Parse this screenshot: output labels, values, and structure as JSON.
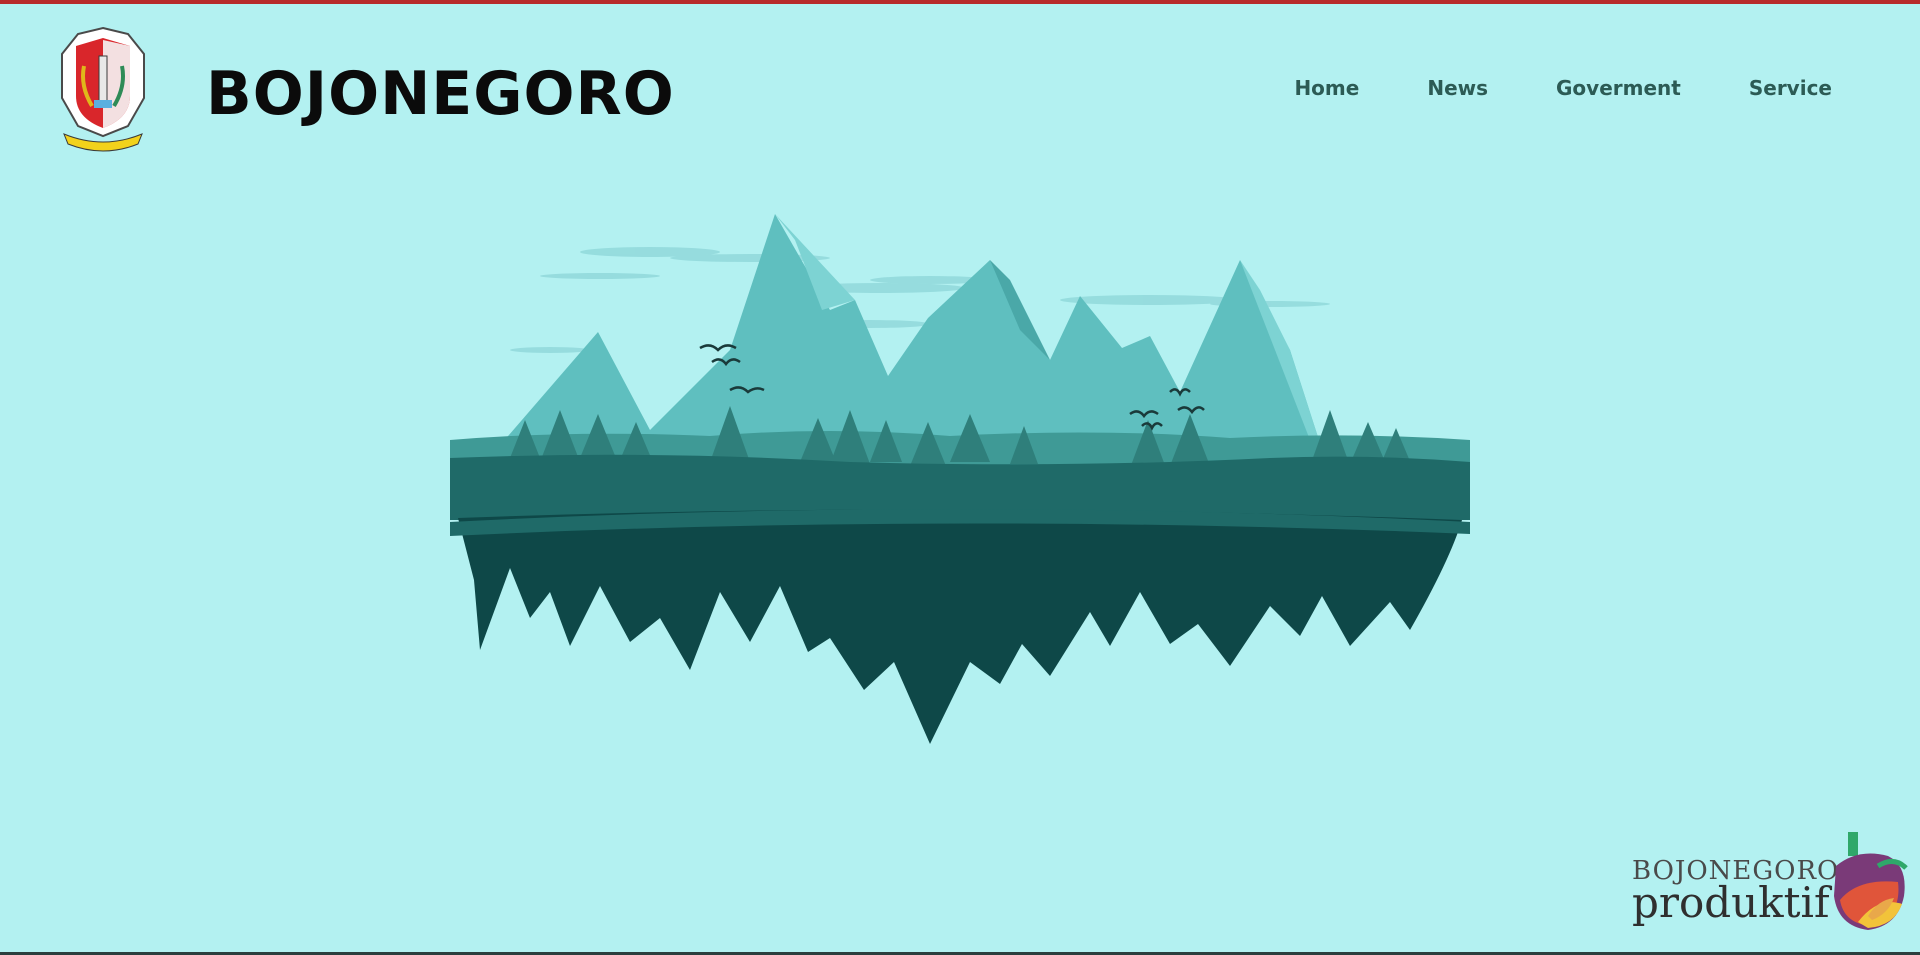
{
  "site": {
    "title": "BOJONEGORO"
  },
  "nav": {
    "items": [
      {
        "label": "Home"
      },
      {
        "label": "News"
      },
      {
        "label": "Goverment"
      },
      {
        "label": "Service"
      }
    ]
  },
  "footer_brand": {
    "line1": "BOJONEGORO",
    "line2": "produktif"
  },
  "colors": {
    "background": "#b3f1f1",
    "top_bar": "#b72b2b",
    "nav_text": "#2c5b55",
    "island_dark": "#0e4848",
    "mountain_light": "#5fbfbf"
  },
  "icons": {
    "crest": "bojonegoro-crest-icon",
    "hero": "floating-island-illustration",
    "brand": "produktif-emblem-icon"
  }
}
